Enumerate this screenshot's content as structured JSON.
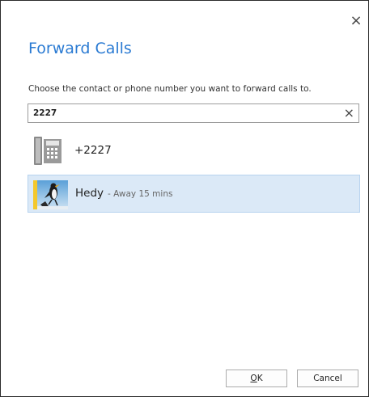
{
  "dialog": {
    "title": "Forward Calls",
    "close_glyph": "×",
    "prompt": "Choose the contact or phone number you want to forward calls to."
  },
  "search": {
    "value": "2227",
    "clear_glyph": "×"
  },
  "results": [
    {
      "type": "phone-number",
      "icon": "desk-phone-icon",
      "label": "+2227"
    },
    {
      "type": "contact",
      "icon": "contact-avatar",
      "name": "Hedy",
      "status": "- Away 15 mins",
      "presence_color": "#f4c82c",
      "selected": true
    }
  ],
  "buttons": {
    "ok_mnemonic": "O",
    "ok_rest": "K",
    "cancel": "Cancel"
  },
  "colors": {
    "title": "#2b7bd3",
    "selected_row": "#dbe9f7",
    "presence_away": "#f4c82c"
  }
}
